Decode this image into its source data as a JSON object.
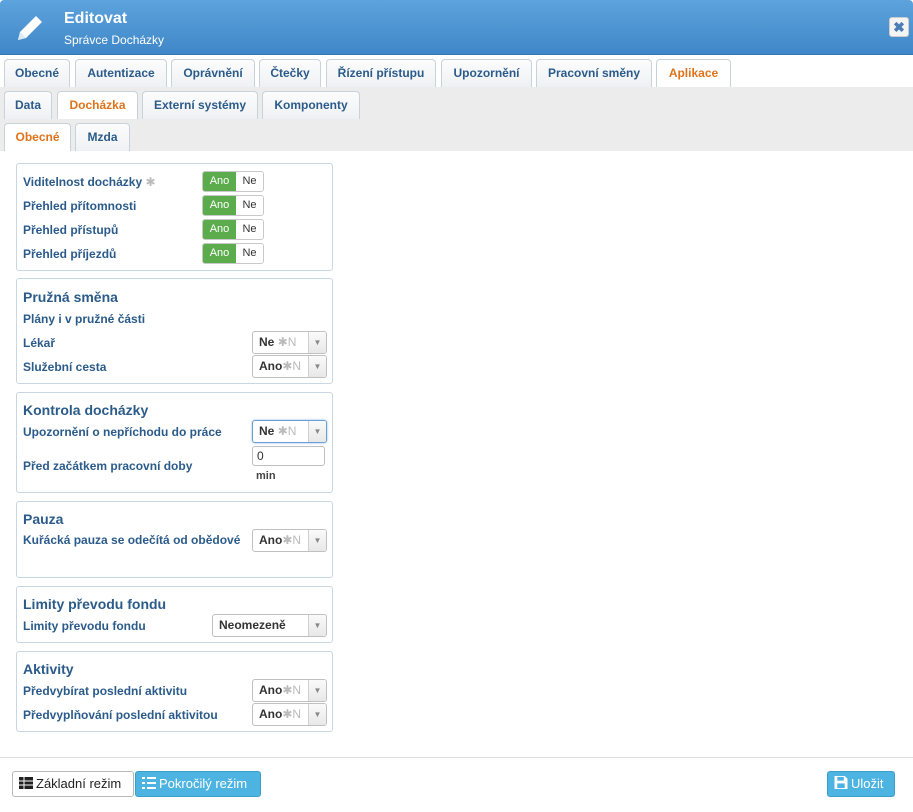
{
  "dialog": {
    "title": "Editovat",
    "subtitle": "Správce Docházky",
    "close_label": "✖"
  },
  "tabs_primary": [
    {
      "label": "Obecné"
    },
    {
      "label": "Autentizace"
    },
    {
      "label": "Oprávnění"
    },
    {
      "label": "Čtečky"
    },
    {
      "label": "Řízení přístupu"
    },
    {
      "label": "Upozornění"
    },
    {
      "label": "Pracovní směny"
    },
    {
      "label": "Aplikace",
      "active": true
    }
  ],
  "tabs_secondary": [
    {
      "label": "Data"
    },
    {
      "label": "Docházka",
      "active": true
    },
    {
      "label": "Externí systémy"
    },
    {
      "label": "Komponenty"
    }
  ],
  "tabs_tertiary": [
    {
      "label": "Obecné",
      "active": true
    },
    {
      "label": "Mzda"
    }
  ],
  "visibility": {
    "rows": [
      {
        "label": "Viditelnost docházky",
        "star": "✱",
        "on": "Ano",
        "off": "Ne"
      },
      {
        "label": "Přehled přítomnosti",
        "on": "Ano",
        "off": "Ne"
      },
      {
        "label": "Přehled přístupů",
        "on": "Ano",
        "off": "Ne"
      },
      {
        "label": "Přehled příjezdů",
        "on": "Ano",
        "off": "Ne"
      }
    ]
  },
  "flex_shift": {
    "heading": "Pružná směna",
    "subtitle": "Plány i v pružné části",
    "rows": [
      {
        "label": "Lékař",
        "value": "Ne",
        "star": "✱N"
      },
      {
        "label": "Služební cesta",
        "value": "Ano",
        "star": "✱N"
      }
    ]
  },
  "attendance_check": {
    "heading": "Kontrola docházky",
    "notice_label": "Upozornění o nepříchodu do práce",
    "notice_value": "Ne",
    "notice_star": "✱N",
    "before_label": "Před začátkem pracovní doby",
    "before_value": "0",
    "before_unit": "min"
  },
  "pause": {
    "heading": "Pauza",
    "label": "Kuřácká pauza se odečítá od obědové",
    "value": "Ano",
    "star": "✱N"
  },
  "fund_limits": {
    "heading": "Limity převodu fondu",
    "label": "Limity převodu fondu",
    "value": "Neomezeně"
  },
  "activities": {
    "heading": "Aktivity",
    "rows": [
      {
        "label": "Předvybírat poslední aktivitu",
        "value": "Ano",
        "star": "✱N"
      },
      {
        "label": "Předvyplňování poslední aktivitou",
        "value": "Ano",
        "star": "✱N"
      }
    ]
  },
  "footer": {
    "basic_mode": "Základní režim",
    "advanced_mode": "Pokročilý režim",
    "save": "Uložit"
  },
  "colors": {
    "accent": "#3f87c8",
    "active_tab": "#e0731a",
    "toggle_on": "#5cab4c",
    "save": "#4db3e0"
  }
}
